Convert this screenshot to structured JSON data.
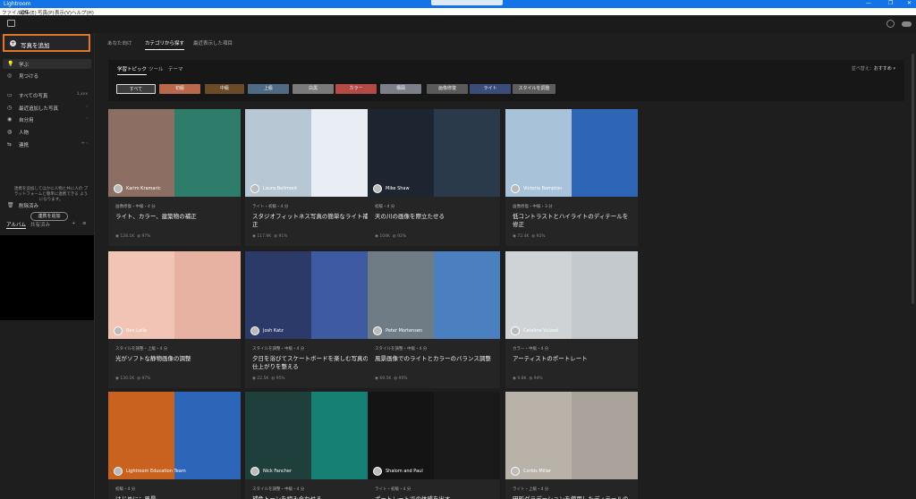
{
  "window": {
    "app_name": "Lightroom",
    "controls": [
      "—",
      "❐",
      "✕"
    ]
  },
  "menu": [
    "ファイル(F)",
    "編集(E)",
    "写真(P)",
    "表示(V)",
    "ヘルプ(H)"
  ],
  "sidebar": {
    "add_photo": "写真を追加",
    "items": [
      {
        "label": "学ぶ",
        "selected": true
      },
      {
        "label": "見つける"
      },
      {
        "label": "すべての写真",
        "meta": "1,xxx"
      },
      {
        "label": "最近追加した写真"
      },
      {
        "label": "自分用"
      },
      {
        "label": "人物"
      },
      {
        "label": "連携"
      },
      {
        "label": "削除済み"
      }
    ],
    "hint": "連携を追加してほかに人物と共に人の プラットフォームと簡単に連携できる ようになります。",
    "create_button": "連携を追加",
    "tabs": [
      "アルバム",
      "共有済み"
    ]
  },
  "main_tabs": [
    {
      "label": "あなた向け"
    },
    {
      "label": "カテゴリから探す",
      "selected": true
    },
    {
      "label": "最近表示した項目"
    }
  ],
  "filter": {
    "tabs": [
      {
        "label": "学習トピック",
        "selected": true
      },
      {
        "label": "ツール"
      },
      {
        "label": "テーマ"
      }
    ],
    "sort_label": "並べ替え：",
    "sort_value": "おすすめ",
    "chips": [
      {
        "label": "すべて",
        "color": "#3d3d3d"
      },
      {
        "label": "初級",
        "color": "#b9694b"
      },
      {
        "label": "中級",
        "color": "#6b4a2a"
      },
      {
        "label": "上級",
        "color": "#4f6a82"
      },
      {
        "label": "白黒",
        "color": "#7a7a7a"
      },
      {
        "label": "カラー",
        "color": "#b44a45"
      },
      {
        "label": "構図",
        "color": "#7a7f88"
      },
      {
        "label": "画像修復",
        "color": "#5a5a5a"
      },
      {
        "label": "ライト",
        "color": "#3a4d78"
      },
      {
        "label": "スタイルを調整",
        "color": "#5c5c5c"
      }
    ]
  },
  "cards": [
    {
      "author": "Karim Kramaric",
      "category": "画像修復・中級・4 分",
      "title": "ライト、カラー、建築物の補正",
      "views": "128.1K",
      "rating": "97%",
      "colors": [
        "#8d6e63",
        "#2e7d6a"
      ]
    },
    {
      "author": "Laura Bellmont",
      "category": "ライト・初級・4 分",
      "title": "スタジオフィットネス写真の簡単なライト補正",
      "views": "117.9K",
      "rating": "91%",
      "colors": [
        "#b7c7d4",
        "#e8eef3"
      ]
    },
    {
      "author": "Mike Shaw",
      "category": "初級・4 分",
      "title": "天の川の画像を際立たせる",
      "views": "104K",
      "rating": "92%",
      "colors": [
        "#1d2630",
        "#2b3a4a"
      ]
    },
    {
      "author": "Victoria Bampton",
      "category": "画像修復・中級・3 分",
      "title": "低コントラストとハイライトのディテールを修正",
      "views": "72.4K",
      "rating": "92%",
      "colors": [
        "#a8c2da",
        "#2e66b5"
      ]
    },
    {
      "author": "Ben Lalla",
      "category": "スタイルを調整・上級・4 分",
      "title": "光がソフトな静物画像の調整",
      "views": "130.1K",
      "rating": "97%",
      "colors": [
        "#f1c4b5",
        "#e8b2a2"
      ]
    },
    {
      "author": "Josh Katz",
      "category": "スタイルを調整・中級・4 分",
      "title": "夕日を浴びてスケートボードを楽しむ写真の仕上がりを整える",
      "views": "22.5K",
      "rating": "95%",
      "colors": [
        "#2c3a6a",
        "#3e5aa0"
      ]
    },
    {
      "author": "Peter Mortensen",
      "category": "スタイルを調整・中級・4 分",
      "title": "風景画像でのライトとカラーのバランス調整",
      "views": "69.5K",
      "rating": "95%",
      "colors": [
        "#6f7c86",
        "#4a80c0"
      ]
    },
    {
      "author": "Cataline Vulzzel",
      "category": "カラー・中級・4 分",
      "title": "アーティストのポートレート",
      "views": "9.8K",
      "rating": "94%",
      "colors": [
        "#cfd3d6",
        "#c4c9cd"
      ]
    },
    {
      "author": "Lightroom Education Team",
      "category": "初級・4 分",
      "title": "はじめに：風景",
      "views": "",
      "rating": "",
      "colors": [
        "#c9611f",
        "#2d66b8"
      ]
    },
    {
      "author": "Nick Fancher",
      "category": "スタイルを調整・中級・4 分",
      "title": "補色トーンを組み合わせる",
      "views": "",
      "rating": "",
      "colors": [
        "#1f3f3c",
        "#178074"
      ]
    },
    {
      "author": "Shalom and Paul",
      "category": "ライト・初級・4 分",
      "title": "ポートレートでの体感を出す",
      "views": "",
      "rating": "",
      "colors": [
        "#141414",
        "#1a1a1a"
      ]
    },
    {
      "author": "Corbis Millar",
      "category": "ライト・上級・4 分",
      "title": "円形グラデーションを使用したディテールの分離",
      "views": "",
      "rating": "",
      "colors": [
        "#b8b2a9",
        "#a9a39b"
      ]
    }
  ]
}
